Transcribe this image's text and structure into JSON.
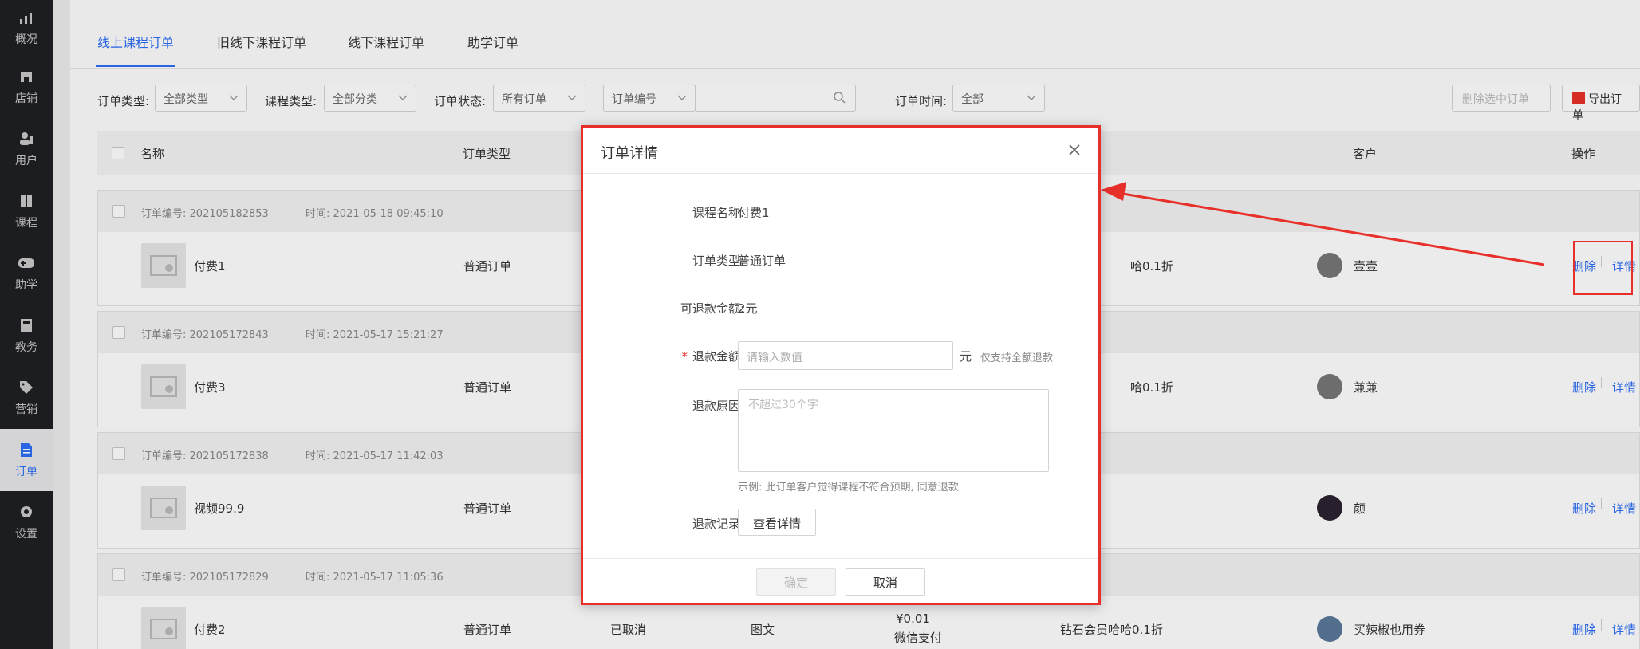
{
  "sidebar": {
    "items": [
      {
        "label": "概况",
        "icon": "chart-icon"
      },
      {
        "label": "店铺",
        "icon": "store-icon"
      },
      {
        "label": "用户",
        "icon": "users-icon"
      },
      {
        "label": "课程",
        "icon": "book-icon"
      },
      {
        "label": "助学",
        "icon": "gamepad-icon"
      },
      {
        "label": "教务",
        "icon": "notebook-icon"
      },
      {
        "label": "营销",
        "icon": "tag-icon"
      },
      {
        "label": "订单",
        "icon": "document-icon"
      },
      {
        "label": "设置",
        "icon": "gear-icon"
      }
    ],
    "active_index": 7
  },
  "tabs": [
    "线上课程订单",
    "旧线下课程订单",
    "线下课程订单",
    "助学订单"
  ],
  "filters": {
    "order_type_label": "订单类型:",
    "order_type_value": "全部类型",
    "course_type_label": "课程类型:",
    "course_type_value": "全部分类",
    "order_status_label": "订单状态:",
    "order_status_value": "所有订单",
    "search_field_value": "订单编号",
    "order_time_label": "订单时间:",
    "order_time_value": "全部",
    "delete_selected": "删除选中订单",
    "export": "导出订单"
  },
  "table": {
    "headers": {
      "name": "名称",
      "type": "订单类型",
      "customer": "客户",
      "actions": "操作"
    },
    "no_label": "订单编号:",
    "time_label": "时间:",
    "delete_label": "删除",
    "detail_label": "详情",
    "rows": [
      {
        "no": "202105182853",
        "time": "2021-05-18 09:45:10",
        "name": "付费1",
        "type": "普通订单",
        "discount": "哈0.1折",
        "customer": "壹壹"
      },
      {
        "no": "202105172843",
        "time": "2021-05-17 15:21:27",
        "name": "付费3",
        "type": "普通订单",
        "discount": "哈0.1折",
        "customer": "兼兼"
      },
      {
        "no": "202105172838",
        "time": "2021-05-17 11:42:03",
        "name": "视频99.9",
        "type": "普通订单",
        "discount": "",
        "customer": "颜"
      },
      {
        "no": "202105172829",
        "time": "2021-05-17 11:05:36",
        "name": "付费2",
        "type": "普通订单",
        "status": "已取消",
        "content": "图文",
        "price": "¥0.01",
        "pay": "微信支付",
        "discount": "钻石会员哈哈0.1折",
        "customer": "买辣椒也用券"
      }
    ]
  },
  "modal": {
    "title": "订单详情",
    "course_name_label": "课程名称:",
    "course_name": "付费1",
    "order_type_label": "订单类型:",
    "order_type": "普通订单",
    "refundable_label": "可退款金额:",
    "refundable": "2元",
    "refund_amount_label": "退款金额:",
    "refund_amount_placeholder": "请输入数值",
    "unit": "元",
    "refund_hint": "仅支持全额退款",
    "refund_reason_label": "退款原因:",
    "refund_reason_placeholder": "不超过30个字",
    "example": "示例: 此订单客户觉得课程不符合预期, 同意退款",
    "refund_record_label": "退款记录:",
    "view_details": "查看详情",
    "confirm": "确定",
    "cancel": "取消"
  },
  "colors": {
    "accent": "#2d6df6",
    "highlight": "#e8302a",
    "sidebar": "#1f2024"
  }
}
